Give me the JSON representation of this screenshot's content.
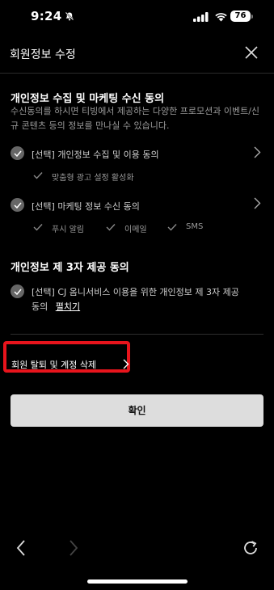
{
  "status_bar": {
    "time": "9:24",
    "battery": "76"
  },
  "header": {
    "title": "회원정보 수정"
  },
  "marketing_section": {
    "title": "개인정보 수집 및 마케팅 수신 동의",
    "description": "수신동의를 하시면 티빙에서 제공하는 다양한 프로모션과 이벤트/신규 콘텐츠 등의 정보를 만나실 수 있습니다.",
    "item1": {
      "label": "[선택] 개인정보 수집 및 이용 동의",
      "sub": "맞춤형 광고 설정 활성화"
    },
    "item2": {
      "label": "[선택] 마케팅 정보 수신 동의",
      "subs": [
        "푸시 알림",
        "이메일",
        "SMS"
      ]
    }
  },
  "third_party_section": {
    "title": "개인정보 제 3자 제공 동의",
    "item_line1": "[선택] CJ 옴니서비스 이용을 위한 개인정보 제 3자 제공",
    "item_line2": "동의",
    "expand_link": "펼치기"
  },
  "withdraw": {
    "label": "회원 탈퇴 및 계정 삭제"
  },
  "confirm_button": "확인",
  "colors": {
    "accent_red": "#e8141c",
    "button_bg": "#dddddd",
    "check_circle": "#666666"
  }
}
